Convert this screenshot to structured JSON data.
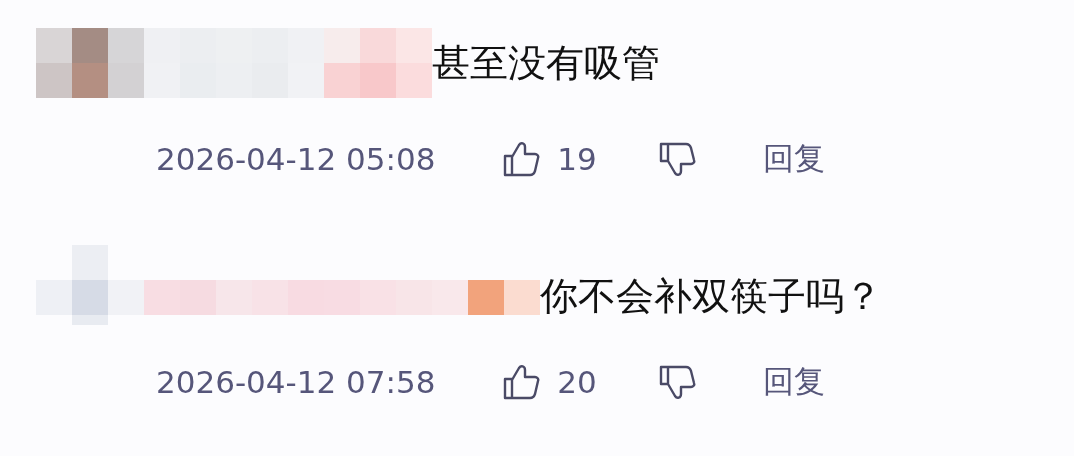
{
  "comments": [
    {
      "text": "甚至没有吸管",
      "time": "2026-04-12 05:08",
      "likes": "19",
      "reply": "回复"
    },
    {
      "text": "你不会补双筷子吗？",
      "time": "2026-04-12 07:58",
      "likes": "20",
      "reply": "回复"
    }
  ]
}
